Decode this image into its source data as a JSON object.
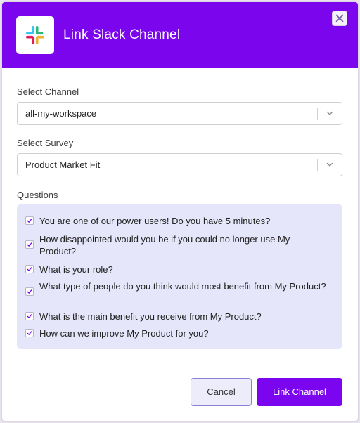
{
  "modal": {
    "title": "Link Slack Channel",
    "brand_color": "#7b06ee",
    "logo_icon": "slack-logo",
    "close_icon": "close-icon"
  },
  "form": {
    "channel": {
      "label": "Select Channel",
      "value": "all-my-workspace"
    },
    "survey": {
      "label": "Select Survey",
      "value": "Product Market Fit"
    },
    "questions_label": "Questions",
    "questions": [
      {
        "text": "You are one of our power users! Do you have 5 minutes?",
        "checked": true
      },
      {
        "text": "How disappointed would you be if you could no longer use My Product?",
        "checked": true
      },
      {
        "text": "What is your role?",
        "checked": true
      },
      {
        "text": "What type of people do you think would most benefit from My Product?",
        "checked": true
      },
      {
        "text": "What is the main benefit you receive from My Product?",
        "checked": true
      },
      {
        "text": "How can we improve My Product for you?",
        "checked": true
      }
    ]
  },
  "footer": {
    "cancel_label": "Cancel",
    "link_label": "Link Channel"
  }
}
